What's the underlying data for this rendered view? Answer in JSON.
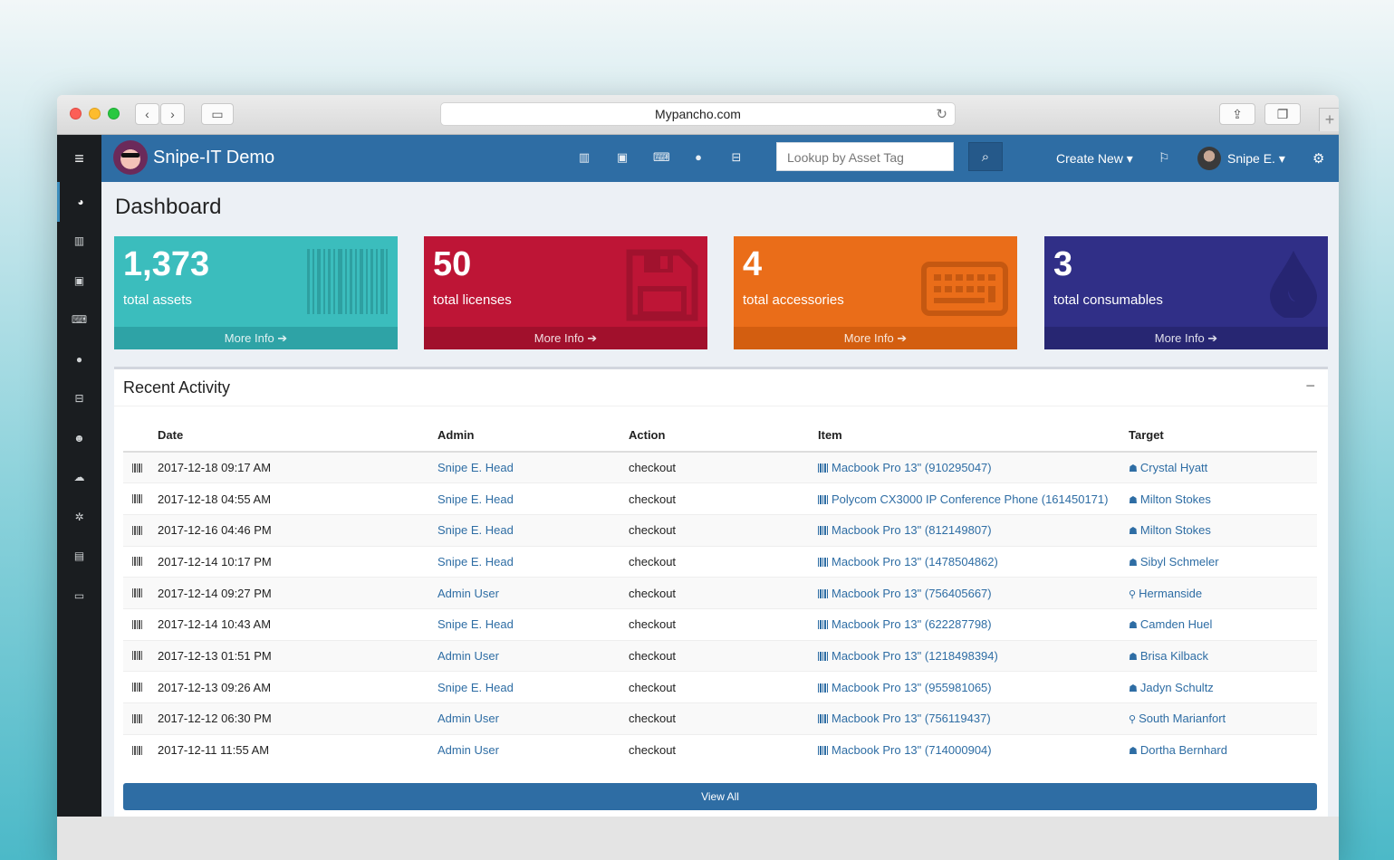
{
  "browser": {
    "url": "Mypancho.com"
  },
  "topbar": {
    "brand": "Snipe-IT Demo",
    "lookup_placeholder": "Lookup by Asset Tag",
    "create_new": "Create New ▾",
    "user_name": "Snipe E. ▾"
  },
  "page": {
    "title": "Dashboard"
  },
  "stats": [
    {
      "count": "1,373",
      "label": "total assets",
      "more": "More Info ➔"
    },
    {
      "count": "50",
      "label": "total licenses",
      "more": "More Info ➔"
    },
    {
      "count": "4",
      "label": "total accessories",
      "more": "More Info ➔"
    },
    {
      "count": "3",
      "label": "total consumables",
      "more": "More Info ➔"
    }
  ],
  "activity": {
    "title": "Recent Activity",
    "columns": [
      "Date",
      "Admin",
      "Action",
      "Item",
      "Target"
    ],
    "rows": [
      {
        "date": "2017-12-18 09:17 AM",
        "admin": "Snipe E. Head",
        "action": "checkout",
        "item": "Macbook Pro 13\" (910295047)",
        "target": "Crystal Hyatt",
        "target_type": "user"
      },
      {
        "date": "2017-12-18 04:55 AM",
        "admin": "Snipe E. Head",
        "action": "checkout",
        "item": "Polycom CX3000 IP Conference Phone (161450171)",
        "target": "Milton Stokes",
        "target_type": "user"
      },
      {
        "date": "2017-12-16 04:46 PM",
        "admin": "Snipe E. Head",
        "action": "checkout",
        "item": "Macbook Pro 13\" (812149807)",
        "target": "Milton Stokes",
        "target_type": "user"
      },
      {
        "date": "2017-12-14 10:17 PM",
        "admin": "Snipe E. Head",
        "action": "checkout",
        "item": "Macbook Pro 13\" (1478504862)",
        "target": "Sibyl Schmeler",
        "target_type": "user"
      },
      {
        "date": "2017-12-14 09:27 PM",
        "admin": "Admin User",
        "action": "checkout",
        "item": "Macbook Pro 13\" (756405667)",
        "target": "Hermanside",
        "target_type": "location"
      },
      {
        "date": "2017-12-14 10:43 AM",
        "admin": "Snipe E. Head",
        "action": "checkout",
        "item": "Macbook Pro 13\" (622287798)",
        "target": "Camden Huel",
        "target_type": "user"
      },
      {
        "date": "2017-12-13 01:51 PM",
        "admin": "Admin User",
        "action": "checkout",
        "item": "Macbook Pro 13\" (1218498394)",
        "target": "Brisa Kilback",
        "target_type": "user"
      },
      {
        "date": "2017-12-13 09:26 AM",
        "admin": "Snipe E. Head",
        "action": "checkout",
        "item": "Macbook Pro 13\" (955981065)",
        "target": "Jadyn Schultz",
        "target_type": "user"
      },
      {
        "date": "2017-12-12 06:30 PM",
        "admin": "Admin User",
        "action": "checkout",
        "item": "Macbook Pro 13\" (756119437)",
        "target": "South Marianfort",
        "target_type": "location"
      },
      {
        "date": "2017-12-11 11:55 AM",
        "admin": "Admin User",
        "action": "checkout",
        "item": "Macbook Pro 13\" (714000904)",
        "target": "Dortha Bernhard",
        "target_type": "user"
      }
    ],
    "view_all": "View All",
    "collapse": "−"
  }
}
